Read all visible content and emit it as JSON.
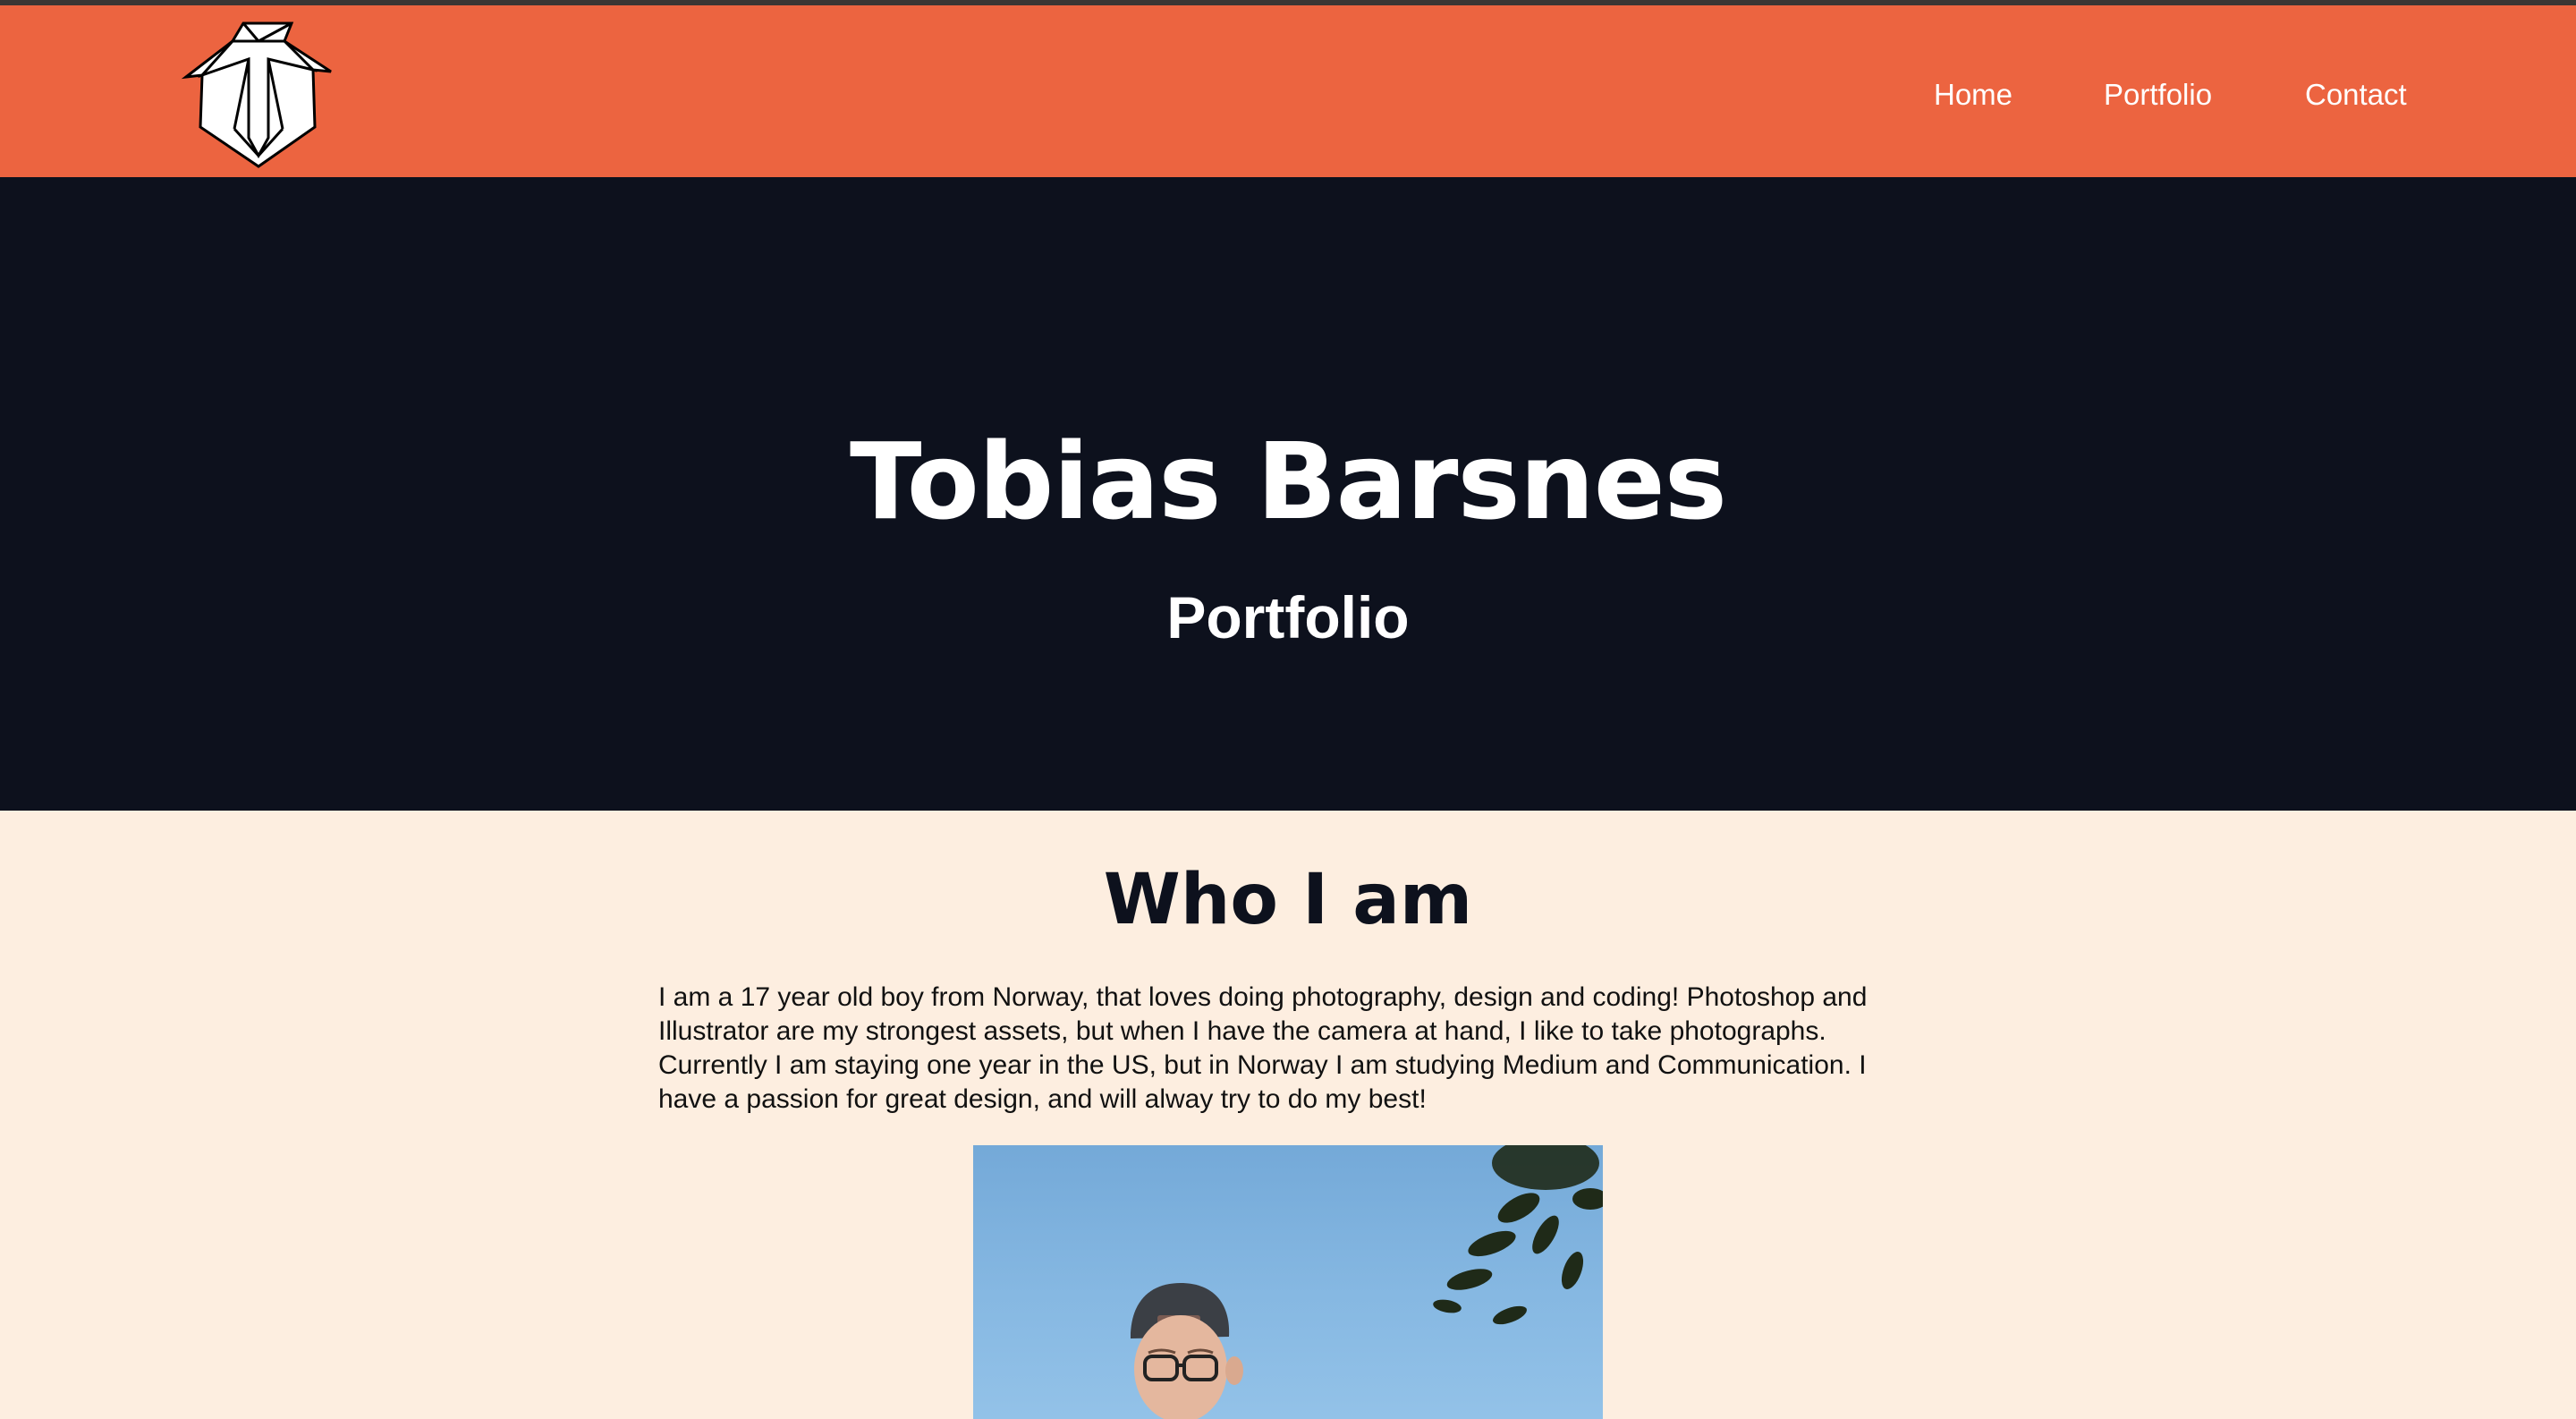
{
  "nav": {
    "logo_icon": "shield-t-logo-icon",
    "links": [
      {
        "label": "Home"
      },
      {
        "label": "Portfolio"
      },
      {
        "label": "Contact"
      }
    ],
    "colors": {
      "background": "#ec6440",
      "text": "#ffffff"
    }
  },
  "hero": {
    "title": "Tobias Barsnes",
    "subtitle": "Portfolio",
    "colors": {
      "background": "#0d111d",
      "text": "#ffffff"
    }
  },
  "about": {
    "heading": "Who I am",
    "body": "I am a 17 year old boy from Norway, that loves doing photography, design and coding! Photoshop and Illustrator are my strongest assets, but when I have the camera at hand, I like to take photographs. Currently I am staying one year in the US, but in Norway I am studying Medium and Communication. I have a passion for great design, and will alway try to do my best!",
    "photo_icon": "portrait-photo",
    "colors": {
      "background": "#fdeee0",
      "heading": "#0d111d"
    }
  }
}
